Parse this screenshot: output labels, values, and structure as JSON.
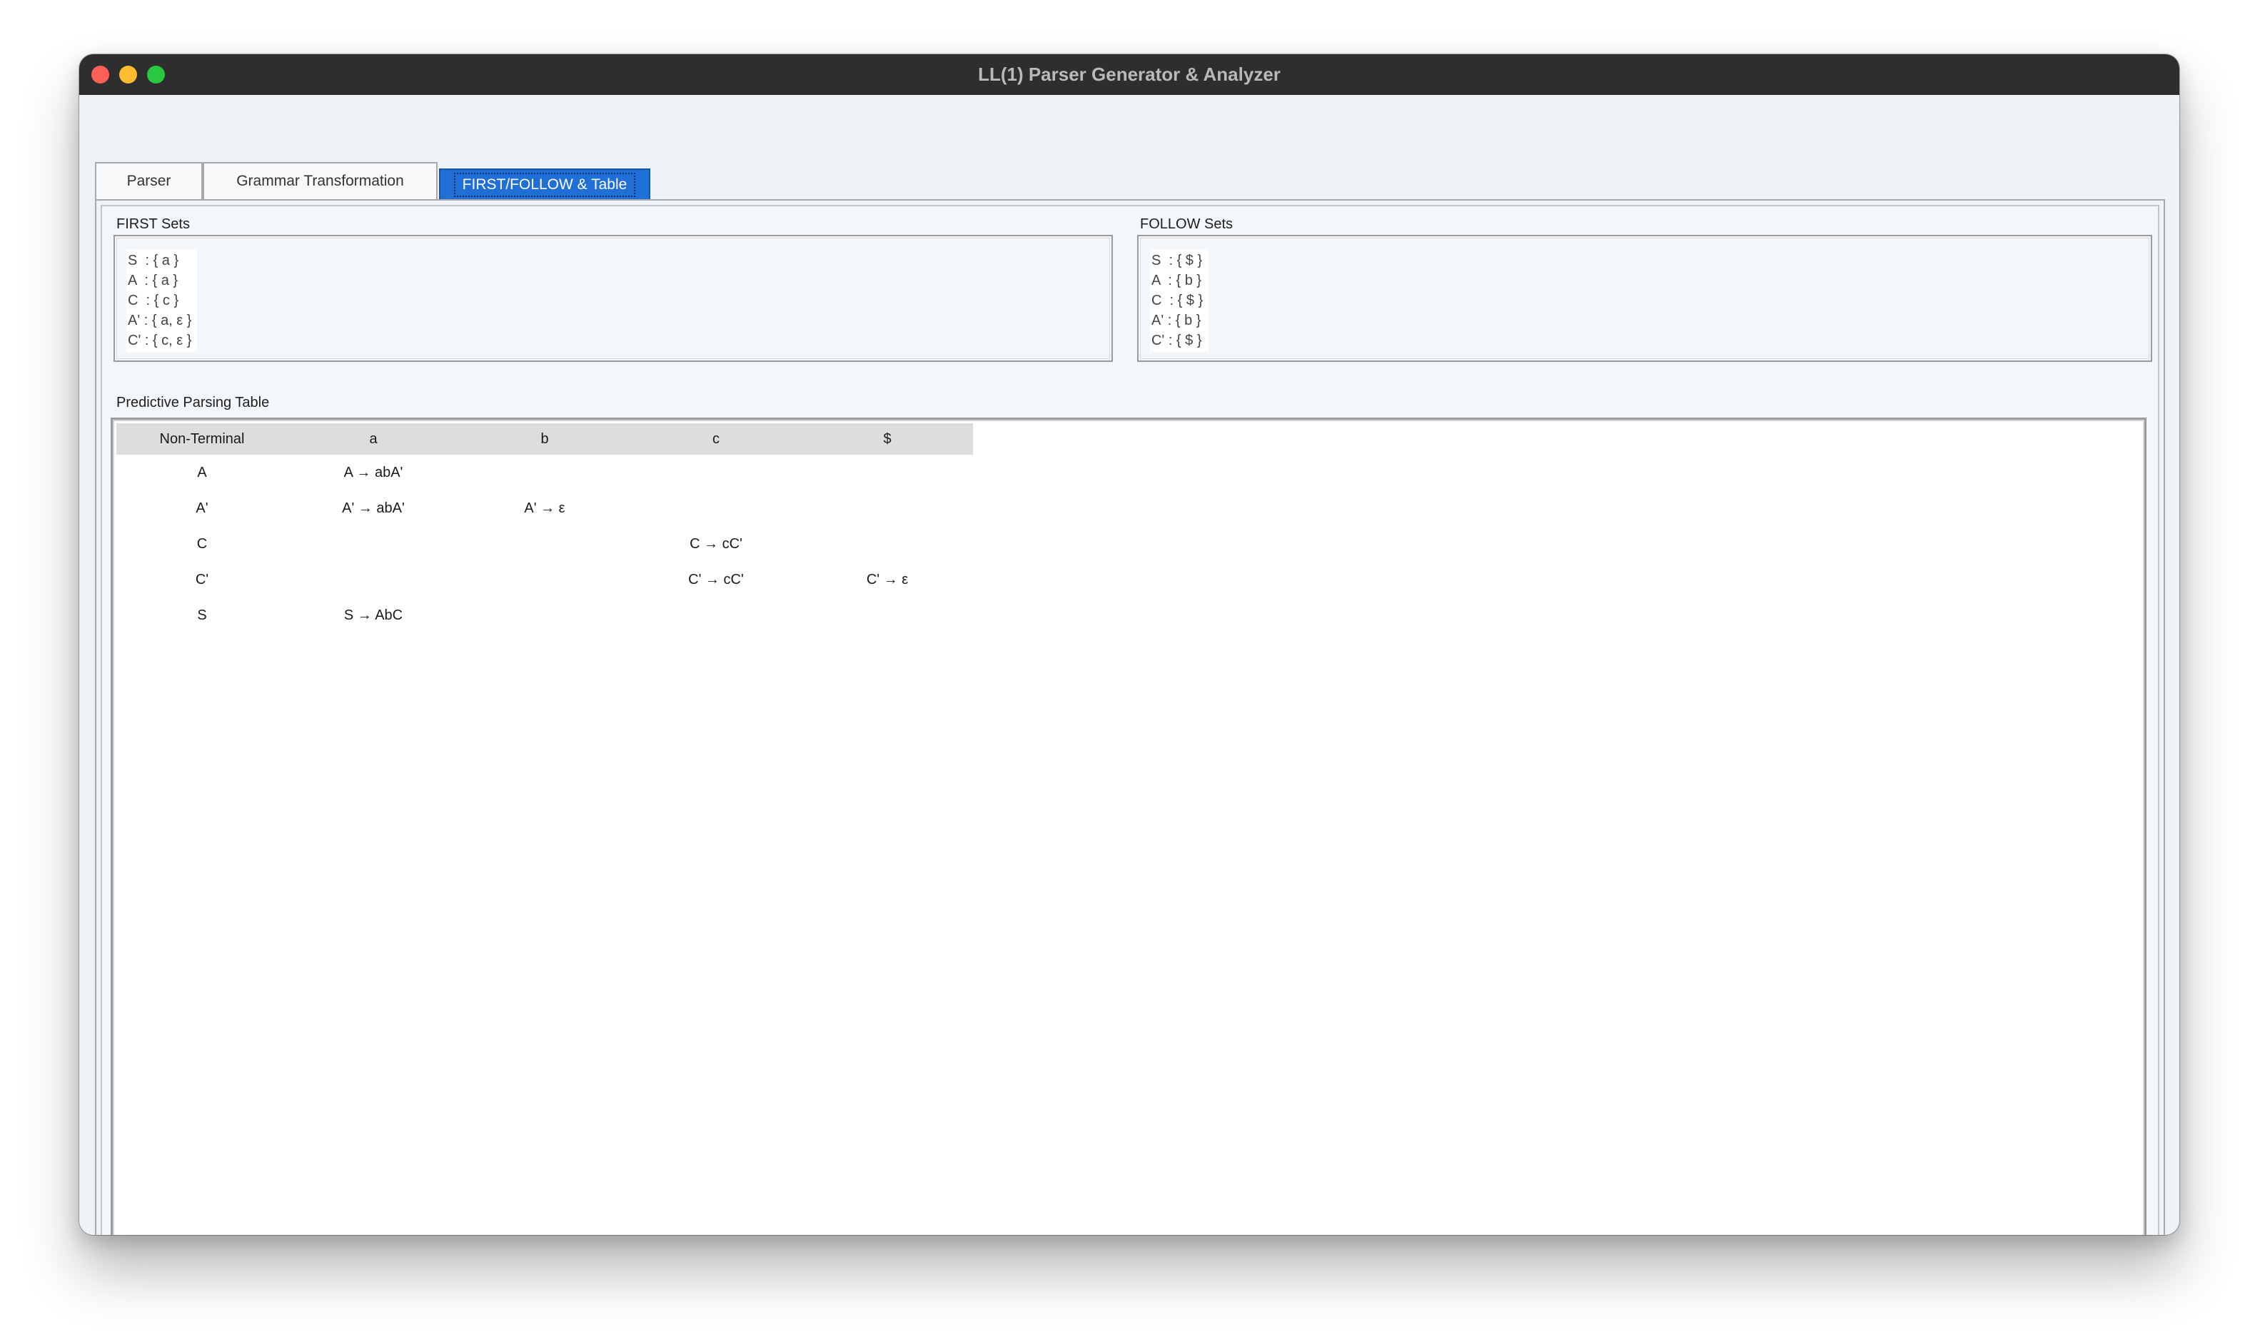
{
  "window": {
    "title": "LL(1) Parser Generator & Analyzer"
  },
  "tabs": [
    {
      "label": "Parser",
      "active": false
    },
    {
      "label": "Grammar Transformation",
      "active": false
    },
    {
      "label": "FIRST/FOLLOW & Table",
      "active": true
    }
  ],
  "first_sets": {
    "title": "FIRST Sets",
    "lines": [
      "S  : { a }",
      "A  : { a }",
      "C  : { c }",
      "A' : { a, ε }",
      "C' : { c, ε }"
    ]
  },
  "follow_sets": {
    "title": "FOLLOW Sets",
    "lines": [
      "S  : { $ }",
      "A  : { b }",
      "C  : { $ }",
      "A' : { b }",
      "C' : { $ }"
    ]
  },
  "parsing_table": {
    "title": "Predictive Parsing Table",
    "columns": [
      "Non-Terminal",
      "a",
      "b",
      "c",
      "$"
    ],
    "rows": [
      [
        "A",
        "A → abA'",
        "",
        "",
        ""
      ],
      [
        "A'",
        "A' → abA'",
        "A' → ε",
        "",
        ""
      ],
      [
        "C",
        "",
        "",
        "C → cC'",
        ""
      ],
      [
        "C'",
        "",
        "",
        "C' → cC'",
        "C' → ε"
      ],
      [
        "S",
        "S → AbC",
        "",
        "",
        ""
      ]
    ]
  },
  "colors": {
    "accent": "#1f6fd6",
    "titlebar": "#2e2e2e",
    "close": "#fe5f57",
    "minimize": "#febc2e",
    "maximize": "#28c840"
  }
}
